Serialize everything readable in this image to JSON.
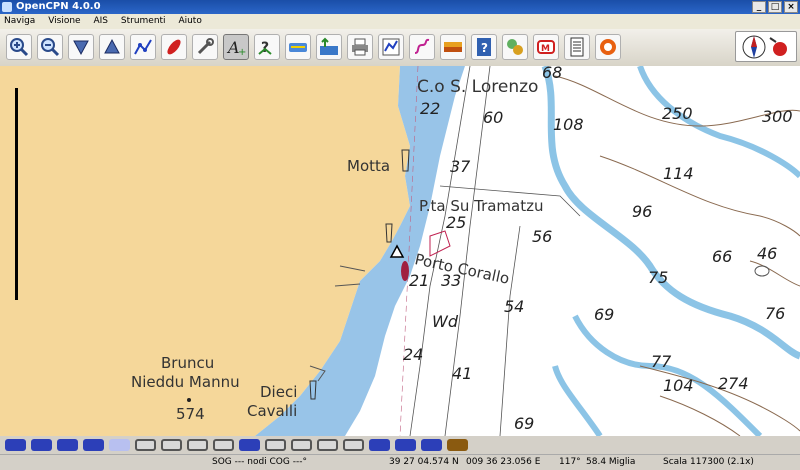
{
  "window": {
    "title": "OpenCPN 4.0.0",
    "minimize": "_",
    "restore": "□",
    "close": "×"
  },
  "menu": [
    "Naviga",
    "Visione",
    "AIS",
    "Strumenti",
    "Aiuto"
  ],
  "toolbar": {
    "buttons": [
      "zoom-in-icon",
      "zoom-out-icon",
      "scale-down-icon",
      "scale-up-icon",
      "route-icon",
      "ship-icon",
      "settings-icon",
      "text-icon",
      "tide-icon",
      "current-icon",
      "color-scheme-icon",
      "print-icon",
      "route-manager-icon",
      "track-icon",
      "moon-icon",
      "help-icon",
      "ais-icon",
      "mob-icon",
      "log-icon",
      "lifebuoy-icon"
    ]
  },
  "chart": {
    "place_labels": [
      "C.o S. Lorenzo",
      "Motta",
      "P.ta Su Tramatzu",
      "Porto Corallo",
      "Bruncu",
      "Nieddu Mannu",
      "574",
      "Dieci",
      "Cavalli",
      "Wd"
    ],
    "soundings": [
      "68",
      "22",
      "60",
      "108",
      "250",
      "300",
      "37",
      "114",
      "96",
      "25",
      "56",
      "66",
      "46",
      "21",
      "33",
      "75",
      "54",
      "69",
      "76",
      "24",
      "77",
      "41",
      "104",
      "274",
      "69"
    ]
  },
  "chartbar": {
    "colors": {
      "blue": "#2c3fb8",
      "lightblue": "#b8c0f0",
      "outline": "#d0d0d0",
      "brown": "#8a5a10"
    },
    "count": 18
  },
  "status": {
    "sog": "SOG --- nodi COG ---°",
    "lat": "39 27 04.574 N",
    "lon": "009 36 23.056 E",
    "bearing": "117°",
    "distance": "58.4 Miglia",
    "scale": "Scala 117300 (2.1x)"
  }
}
